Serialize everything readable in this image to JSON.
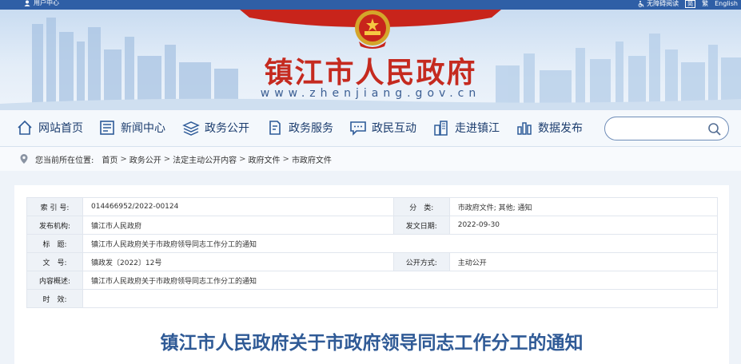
{
  "topbar": {
    "user_center": "用户中心",
    "accessibility": "无障碍阅读",
    "simplified": "简",
    "traditional": "繁",
    "english": "English"
  },
  "header": {
    "site_title": "镇江市人民政府",
    "site_url": "www.zhenjiang.gov.cn"
  },
  "nav": {
    "items": [
      {
        "label": "网站首页",
        "icon": "home-icon"
      },
      {
        "label": "新闻中心",
        "icon": "news-icon"
      },
      {
        "label": "政务公开",
        "icon": "layers-icon"
      },
      {
        "label": "政务服务",
        "icon": "document-edit-icon"
      },
      {
        "label": "政民互动",
        "icon": "chat-icon"
      },
      {
        "label": "走进镇江",
        "icon": "buildings-icon"
      },
      {
        "label": "数据发布",
        "icon": "bar-chart-icon"
      }
    ],
    "search_placeholder": ""
  },
  "breadcrumb": {
    "label": "您当前所在位置:",
    "items": [
      "首页",
      "政务公开",
      "法定主动公开内容",
      "政府文件",
      "市政府文件"
    ],
    "separator": ">"
  },
  "meta": {
    "index_key": "索 引 号:",
    "index_val": "014466952/2022-00124",
    "category_key": "分　类:",
    "category_val": "市政府文件; 其他; 通知",
    "issuer_key": "发布机构:",
    "issuer_val": "镇江市人民政府",
    "date_key": "发文日期:",
    "date_val": "2022-09-30",
    "title_key": "标　题:",
    "title_val": "镇江市人民政府关于市政府领导同志工作分工的通知",
    "docno_key": "文　号:",
    "docno_val": "镇政发〔2022〕12号",
    "disclosure_key": "公开方式:",
    "disclosure_val": "主动公开",
    "summary_key": "内容概述:",
    "summary_val": "镇江市人民政府关于市政府领导同志工作分工的通知",
    "validity_key": "时　效:",
    "validity_val": ""
  },
  "document": {
    "title": "镇江市人民政府关于市政府领导同志工作分工的通知"
  },
  "colors": {
    "topbar": "#2f5fa6",
    "title_red": "#c52a1f",
    "nav_text": "#1c3d6e",
    "doc_title": "#2f5a96"
  }
}
